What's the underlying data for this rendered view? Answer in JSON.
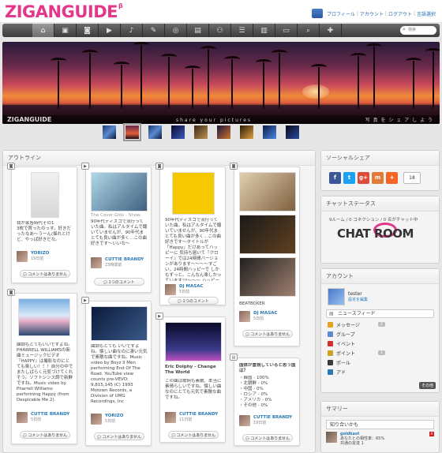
{
  "header": {
    "logo": "ZIGANGUIDE",
    "logo_badge": "β",
    "links": [
      "プロフィール",
      "アカウント",
      "ログアウト",
      "言語選択"
    ]
  },
  "nav": {
    "items": [
      {
        "name": "home-icon",
        "glyph": "⌂"
      },
      {
        "name": "photo-icon",
        "glyph": "▣"
      },
      {
        "name": "instagram-icon",
        "glyph": "◙"
      },
      {
        "name": "video-icon",
        "glyph": "▶"
      },
      {
        "name": "music-icon",
        "glyph": "♪"
      },
      {
        "name": "blog-icon",
        "glyph": "✎"
      },
      {
        "name": "shop-icon",
        "glyph": "◎"
      },
      {
        "name": "event-icon",
        "glyph": "▤"
      },
      {
        "name": "group-icon",
        "glyph": "⚇"
      },
      {
        "name": "forum-icon",
        "glyph": "☰"
      },
      {
        "name": "ranking-icon",
        "glyph": "▥"
      },
      {
        "name": "chat-icon",
        "glyph": "▭"
      },
      {
        "name": "search-icon",
        "glyph": "⌕"
      },
      {
        "name": "add-icon",
        "glyph": "✚"
      }
    ],
    "search_placeholder": "検索"
  },
  "hero": {
    "logo": "ZIGANGUIDE",
    "tagline": "share your pictures",
    "jp_tagline": "写 真 を シ ェ ア し よ う"
  },
  "outline": {
    "title": "アウトライン",
    "cards": [
      {
        "type": "photo",
        "text": "我が家各時代その1\n 3枚で買ったのっす。好きだったなあ〜うーん(揺れとけど、やっぱ好きだな。",
        "user": "YORIZO",
        "date": "19日前",
        "button": "コメントはありません"
      },
      {
        "type": "photo",
        "text": "曲調もとてもいいですよね。PHARRELL WILLIAMSの新曲ミュージックビデオ『HAPPY』は撮影なのにとても楽しい！！！自分の中でまたしばらく元気づけてくれそう。ソフトシンス調で新鮮ですね。Music video by Pharrell Williams performing Happy (from Despicable Me 2).",
        "user": "CUTTIE BRANDY",
        "date": "5日前",
        "button": "コメントはありません"
      },
      {
        "type": "video",
        "title": "The Cover Girls - Show Me",
        "text": "90年代ディスコで流行っていた曲。私はアルタイムで聴いていませんが、90年代まとても良い曲が多く…この曲好きです〜いいな〜",
        "user": "CUTTIE BRANDY",
        "date": "23時間前",
        "button": "1つのコメント"
      },
      {
        "type": "video",
        "text": "曲調もとても いいですよね。懐しい曲なのに凄い元気で素敵な曲ですね。Music video by Boyz II Men performing End Of The Road. YouTube view counts pre-VEVO: 9,815,145 (C) 1993 Motown Records, a Division of UMG Recordings, Inc",
        "user": "YORIZO",
        "date": "5日前",
        "button": "コメントはありません"
      },
      {
        "type": "photo",
        "text": "90年代ディスコで流行っていた曲。私はアルタイムで聴いていませんが、90年代まとても良い曲が多く…この曲好きです〜タイトルが「Happy」だけあってハッピーに 気持ち届いて『クローイ』では24時間バージョンがあります〜〜〜〜すごい。24時間ハッピーで しかもずっと。こんなん楽しかっています!!!〜〜〜 ハッピーに ハッピーに!!!",
        "user": "DJ MASAC",
        "date": "5日前",
        "button": "1つのコメント"
      },
      {
        "type": "video",
        "title": "Eric Dolphy - Change The World",
        "text": "この曲は歌詞も素敵、本当に素晴らしいですね。懐しい曲なのにとても元気で素敵な曲ですね。",
        "user": "CUTTIE BRANDY",
        "date": "11日前",
        "button": "コメントはありません"
      },
      {
        "type": "photo",
        "caption": "BEATBOXER",
        "user": "DJ MASAC",
        "date": "5日前",
        "button": "コメントはありません"
      },
      {
        "type": "poll",
        "title": "国体が重視していると思う国は？",
        "options": [
          "・韓国 - 100%",
          "・北朝鮮 - 0%",
          "・中国 - 0%",
          "・ロシア - 0%",
          "・アメリカ - 0%",
          "・その他 - 0%"
        ],
        "user": "CUTTIE BRANDY",
        "date": "19日前",
        "button": "コメントはありません"
      }
    ]
  },
  "side": {
    "social": {
      "title": "ソーシャルシェア",
      "count": "18",
      "buttons": [
        {
          "label": "f",
          "color": "#3b5998"
        },
        {
          "label": "t",
          "color": "#1da1f2"
        },
        {
          "label": "g+",
          "color": "#dd4b39"
        },
        {
          "label": "m",
          "color": "#e07b39"
        },
        {
          "label": "+",
          "color": "#f26522"
        }
      ]
    },
    "chat": {
      "title": "チャットステータス",
      "status": "9ルーム / 0 コネクション / 0 名がチャット中",
      "logo": "CHAT ROOM"
    },
    "account": {
      "title": "アカウント",
      "name": "tester",
      "edit": "設定を編集",
      "newsfeed": "ニュースフィード",
      "menu": [
        {
          "label": "メッセージ",
          "badge": "2",
          "color": "#e8a020"
        },
        {
          "label": "グループ",
          "badge": "",
          "color": "#5a8ad0"
        },
        {
          "label": "イベント",
          "badge": "",
          "color": "#d03030"
        },
        {
          "label": "ポイント",
          "badge": "1",
          "color": "#d0a020"
        },
        {
          "label": "ポール",
          "badge": "",
          "color": "#3a3a3a"
        },
        {
          "label": "アド",
          "badge": "",
          "color": "#2a7ab5"
        }
      ],
      "more": "その他"
    },
    "summary": {
      "title": "サマリー",
      "tab": "知り合いかも",
      "item_name": "goldkast",
      "item_text": "あなたとの相性率：65%",
      "item_sub": "共通の友達 1"
    }
  }
}
